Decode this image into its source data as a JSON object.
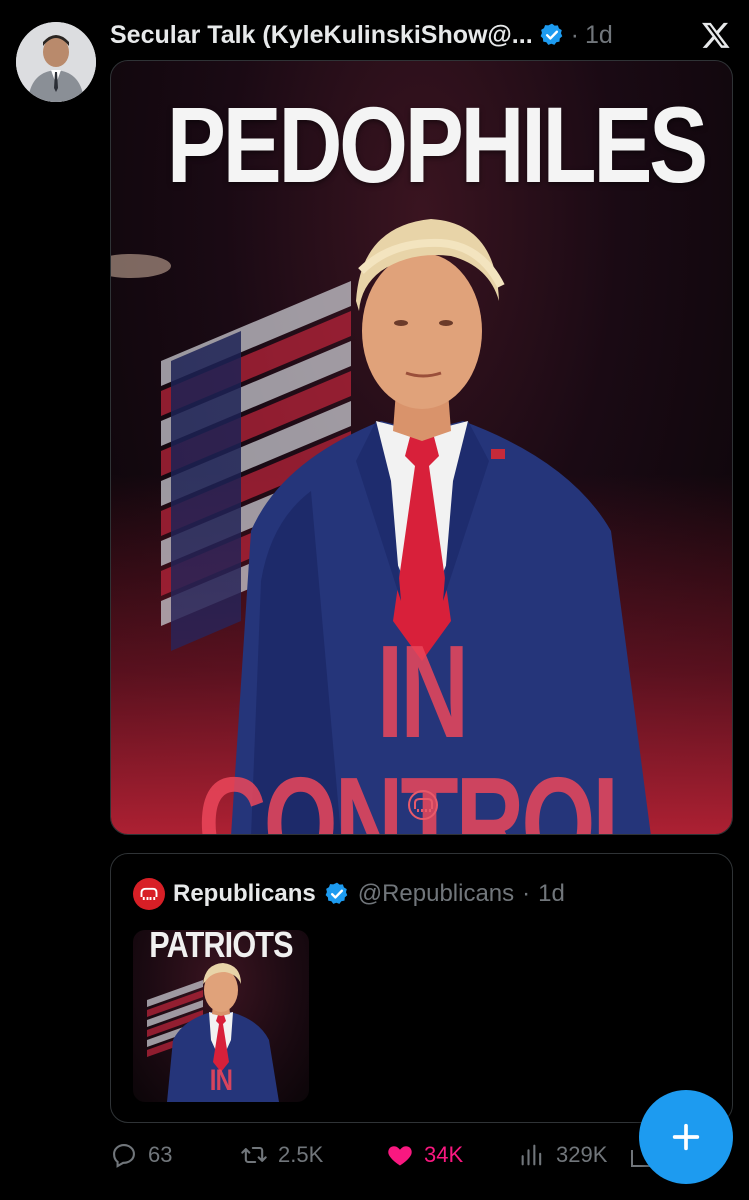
{
  "tweet": {
    "author_name": "Secular Talk (KyleKulinskiShow@...",
    "separator": "·",
    "time": "1d",
    "platform_icon": "x-logo-icon",
    "media": {
      "headline_top": "PEDOPHILES",
      "headline_bottom": "IN CONTROL"
    }
  },
  "quote": {
    "name": "Republicans",
    "handle": "@Republicans",
    "separator": "·",
    "time": "1d",
    "thumb_top": "PATRIOTS",
    "thumb_bottom": "IN CONTROL"
  },
  "actions": {
    "replies": "63",
    "reposts": "2.5K",
    "likes": "34K",
    "views": "329K"
  },
  "colors": {
    "accent": "#1d9bf0",
    "like": "#f91880",
    "muted": "#71767b",
    "background": "#000000"
  }
}
